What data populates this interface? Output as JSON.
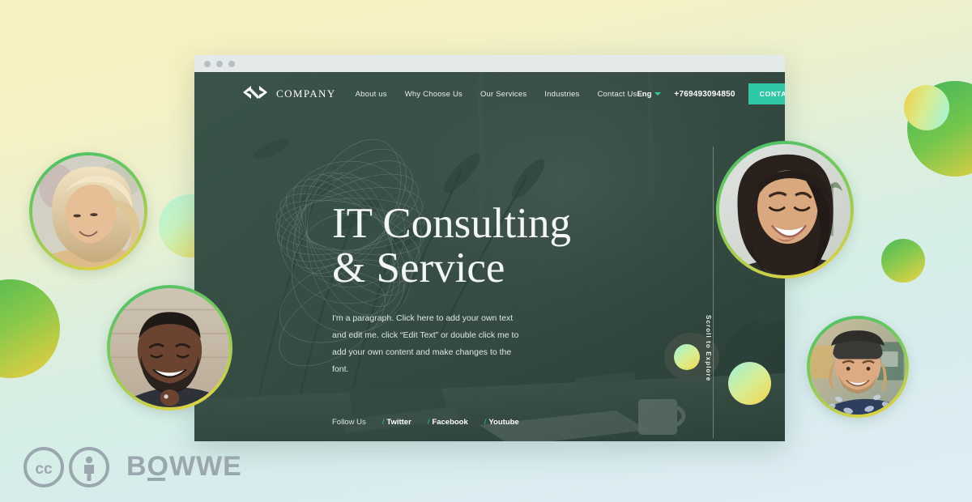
{
  "page": {
    "background_top_color": "#f8f2c0",
    "background_bottom_color": "#dfedf5",
    "accent_color": "#2ec8a6",
    "ring_gradient_from": "#45c06a",
    "ring_gradient_to": "#f3d33f"
  },
  "browser": {
    "dots": [
      "dot-1",
      "dot-2",
      "dot-3"
    ]
  },
  "site": {
    "brand": {
      "logo_icon": "company-infinity-logo-icon",
      "name": "COMPANY"
    },
    "nav_links": [
      {
        "label": "About us"
      },
      {
        "label": "Why Choose Us"
      },
      {
        "label": "Our Services"
      },
      {
        "label": "Industries"
      },
      {
        "label": "Contact Us"
      }
    ],
    "language": {
      "label": "Eng",
      "chevron_icon": "chevron-down-icon"
    },
    "phone": "+769493094850",
    "cta_button": "CONTACT US",
    "hero": {
      "title_line_1": "IT Consulting",
      "title_line_2": "& Service",
      "paragraph": "I'm a paragraph. Click here to add your own text and edit me. click “Edit Text” or double click me to add your own content and make changes to the font.",
      "scroll_hint": "Scroll to Explore"
    },
    "footer": {
      "follow_label": "Follow Us",
      "social_links": [
        {
          "slash": "/",
          "label": "Twitter"
        },
        {
          "slash": "/",
          "label": "Facebook"
        },
        {
          "slash": "/",
          "label": "Youtube"
        }
      ]
    }
  },
  "portraits": [
    {
      "name": "portrait-blonde-woman",
      "alt": "smiling blonde woman with windblown hair"
    },
    {
      "name": "portrait-bearded-man",
      "alt": "laughing bearded man touching chin"
    },
    {
      "name": "portrait-laughing-woman",
      "alt": "laughing woman with dark hair outdoors"
    },
    {
      "name": "portrait-man-with-cap",
      "alt": "smiling man wearing backwards cap and patterned shirt"
    }
  ],
  "spheres": [
    {
      "name": "sphere-mint-yellow-left"
    },
    {
      "name": "sphere-green-yellow-far-left"
    },
    {
      "name": "sphere-green-yellow-right-large"
    },
    {
      "name": "sphere-yellow-cyan-right-small"
    },
    {
      "name": "sphere-green-yellow-right-mid"
    },
    {
      "name": "sphere-mint-yellow-overlay-small"
    },
    {
      "name": "sphere-mint-yellow-overlay-large"
    }
  ],
  "badges": {
    "cc_icon": "creative-commons-icon",
    "by_icon": "creative-commons-attribution-icon",
    "wordmark": "BOWWE"
  }
}
